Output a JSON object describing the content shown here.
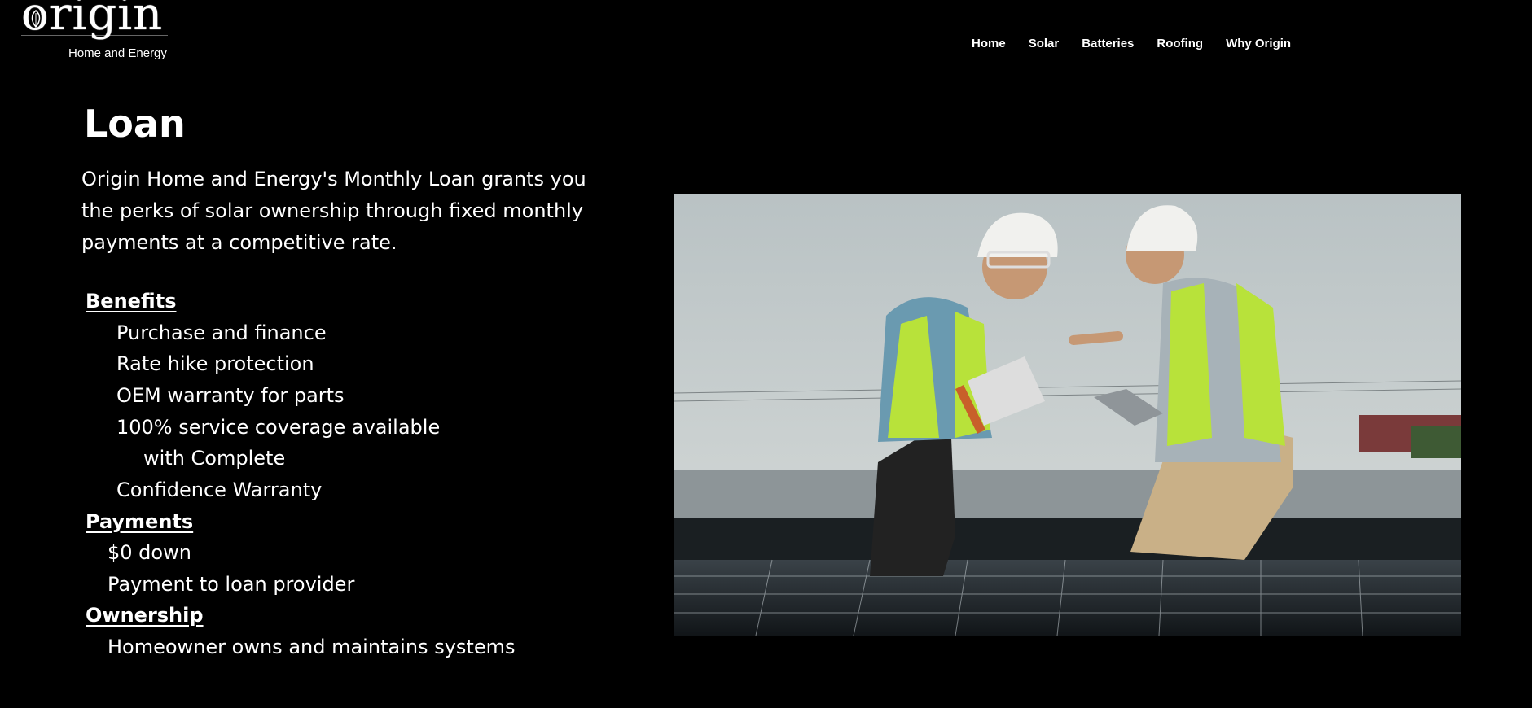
{
  "brand": {
    "logo_text": "origin",
    "tagline": "Home and Energy"
  },
  "nav": {
    "items": [
      "Home",
      "Solar",
      "Batteries",
      "Roofing",
      "Why Origin"
    ]
  },
  "page": {
    "title": "Loan",
    "intro": "Origin Home and Energy's Monthly Loan grants you the perks of solar ownership through fixed monthly payments at a competitive rate.",
    "benefits": {
      "heading": "Benefits",
      "items": [
        "Purchase and finance",
        "Rate hike protection",
        "OEM warranty for parts",
        "100% service coverage available",
        "with Complete",
        "Confidence Warranty"
      ]
    },
    "payments": {
      "heading": "Payments",
      "items": [
        "$0 down",
        "Payment to loan provider"
      ]
    },
    "ownership": {
      "heading": "Ownership",
      "items": [
        "Homeowner owns and maintains systems"
      ]
    }
  },
  "colors": {
    "background": "#000000",
    "text": "#ffffff",
    "vest": "#b8e23a"
  }
}
